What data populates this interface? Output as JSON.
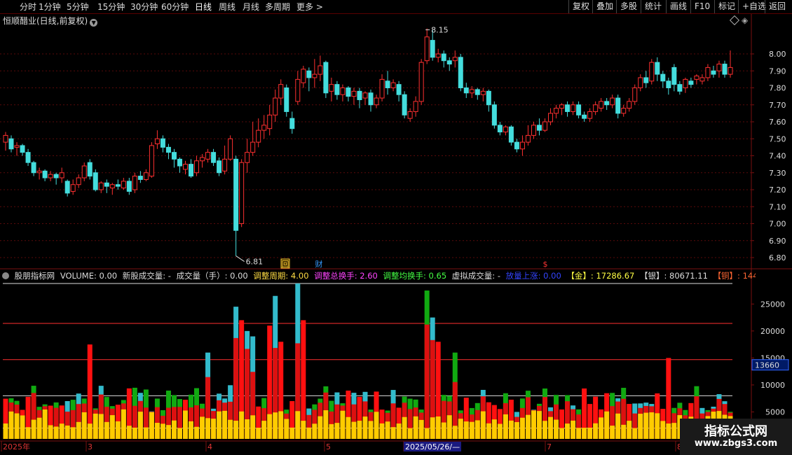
{
  "toolbar": {
    "periods": [
      "分时",
      "1分钟",
      "5分钟",
      "15分钟",
      "30分钟",
      "60分钟",
      "日线",
      "周线",
      "月线",
      "多周期",
      "更多 >"
    ],
    "active_period": "日线",
    "right_buttons": [
      "复权",
      "叠加",
      "多股",
      "统计",
      "画线",
      "F10",
      "标记",
      "+自选",
      "返回"
    ]
  },
  "chart": {
    "title": "恒顺醋业(日线,前复权)",
    "price_axis": [
      "8.00",
      "7.90",
      "7.80",
      "7.70",
      "7.60",
      "7.50",
      "7.40",
      "7.30",
      "7.20",
      "7.10",
      "7.00",
      "6.90",
      "6.80"
    ],
    "high_label": "8.15",
    "low_label": "6.81",
    "markers": [
      "回",
      "财",
      "$"
    ],
    "colors": {
      "up": "#ff3030",
      "down": "#44dddd",
      "grid": "#7a1010"
    }
  },
  "indicator": {
    "name": "股朋指标网",
    "volume": "VOLUME: 0.00",
    "new_stock": "新股成交量: -",
    "vol_hand": "成交量（手）: 0.00",
    "adj_period": "调整周期: 4.00",
    "adj_total_turn": "调整总换手: 2.60",
    "adj_avg_turn": "调整均换手: 0.65",
    "virtual_vol": "虚拟成交量: -",
    "vol_up": "放量上涨: 0.00",
    "gold": "【金】: 17286.67",
    "silver": "【银】: 80671.11",
    "copper": "【铜】: 144055.55",
    "axis": [
      "25000",
      "20000",
      "15000",
      "10000",
      "5000"
    ],
    "current_value": "13660"
  },
  "date_axis": {
    "labels": [
      "2025年",
      "3",
      "4",
      "5",
      "2025/05/26/—",
      "7",
      "8"
    ]
  },
  "watermark": {
    "title": "指标公式网",
    "url": "www.zbgs3.com"
  },
  "chart_data": {
    "type": "candlestick",
    "price_range": [
      6.8,
      8.15
    ],
    "candles": [
      [
        7.48,
        7.52,
        7.43,
        7.54
      ],
      [
        7.5,
        7.44,
        7.42,
        7.52
      ],
      [
        7.45,
        7.46,
        7.4,
        7.48
      ],
      [
        7.46,
        7.42,
        7.4,
        7.47
      ],
      [
        7.42,
        7.36,
        7.34,
        7.44
      ],
      [
        7.36,
        7.3,
        7.28,
        7.37
      ],
      [
        7.3,
        7.31,
        7.26,
        7.33
      ],
      [
        7.31,
        7.27,
        7.25,
        7.32
      ],
      [
        7.27,
        7.29,
        7.25,
        7.31
      ],
      [
        7.29,
        7.27,
        7.23,
        7.3
      ],
      [
        7.27,
        7.3,
        7.24,
        7.33
      ],
      [
        7.25,
        7.18,
        7.16,
        7.26
      ],
      [
        7.19,
        7.23,
        7.17,
        7.26
      ],
      [
        7.23,
        7.27,
        7.21,
        7.29
      ],
      [
        7.27,
        7.34,
        7.25,
        7.36
      ],
      [
        7.36,
        7.28,
        7.26,
        7.38
      ],
      [
        7.3,
        7.2,
        7.19,
        7.32
      ],
      [
        7.2,
        7.24,
        7.18,
        7.25
      ],
      [
        7.24,
        7.22,
        7.18,
        7.26
      ],
      [
        7.21,
        7.23,
        7.17,
        7.24
      ],
      [
        7.23,
        7.22,
        7.2,
        7.26
      ],
      [
        7.21,
        7.25,
        7.2,
        7.27
      ],
      [
        7.25,
        7.19,
        7.17,
        7.27
      ],
      [
        7.2,
        7.28,
        7.18,
        7.3
      ],
      [
        7.28,
        7.26,
        7.24,
        7.31
      ],
      [
        7.26,
        7.3,
        7.25,
        7.32
      ],
      [
        7.28,
        7.46,
        7.27,
        7.48
      ],
      [
        7.47,
        7.5,
        7.44,
        7.55
      ],
      [
        7.5,
        7.45,
        7.42,
        7.52
      ],
      [
        7.45,
        7.42,
        7.38,
        7.47
      ],
      [
        7.42,
        7.38,
        7.33,
        7.44
      ],
      [
        7.38,
        7.34,
        7.3,
        7.39
      ],
      [
        7.32,
        7.35,
        7.29,
        7.37
      ],
      [
        7.35,
        7.28,
        7.27,
        7.38
      ],
      [
        7.3,
        7.37,
        7.28,
        7.4
      ],
      [
        7.37,
        7.39,
        7.33,
        7.41
      ],
      [
        7.38,
        7.42,
        7.36,
        7.44
      ],
      [
        7.42,
        7.36,
        7.34,
        7.44
      ],
      [
        7.37,
        7.3,
        7.28,
        7.39
      ],
      [
        7.31,
        7.38,
        7.29,
        7.46
      ],
      [
        7.38,
        7.5,
        7.37,
        7.52
      ],
      [
        7.38,
        6.96,
        6.81,
        7.4
      ],
      [
        7.0,
        7.36,
        6.98,
        7.38
      ],
      [
        7.36,
        7.42,
        7.3,
        7.5
      ],
      [
        7.42,
        7.48,
        7.4,
        7.6
      ],
      [
        7.48,
        7.55,
        7.45,
        7.62
      ],
      [
        7.55,
        7.58,
        7.5,
        7.64
      ],
      [
        7.56,
        7.64,
        7.52,
        7.7
      ],
      [
        7.64,
        7.74,
        7.6,
        7.79
      ],
      [
        7.74,
        7.82,
        7.7,
        7.85
      ],
      [
        7.8,
        7.66,
        7.63,
        7.82
      ],
      [
        7.62,
        7.56,
        7.53,
        7.66
      ],
      [
        7.72,
        7.85,
        7.7,
        7.9
      ],
      [
        7.83,
        7.91,
        7.8,
        7.93
      ],
      [
        7.9,
        7.86,
        7.78,
        7.92
      ],
      [
        7.86,
        7.88,
        7.8,
        7.97
      ],
      [
        7.88,
        7.93,
        7.84,
        7.99
      ],
      [
        7.95,
        7.77,
        7.74,
        7.96
      ],
      [
        7.78,
        7.82,
        7.72,
        7.86
      ],
      [
        7.82,
        7.76,
        7.73,
        7.84
      ],
      [
        7.76,
        7.8,
        7.72,
        7.82
      ],
      [
        7.8,
        7.75,
        7.72,
        7.81
      ],
      [
        7.75,
        7.78,
        7.7,
        7.8
      ],
      [
        7.78,
        7.73,
        7.68,
        7.8
      ],
      [
        7.74,
        7.77,
        7.7,
        7.78
      ],
      [
        7.77,
        7.7,
        7.66,
        7.79
      ],
      [
        7.7,
        7.74,
        7.68,
        7.76
      ],
      [
        7.74,
        7.85,
        7.72,
        7.88
      ],
      [
        7.84,
        7.8,
        7.76,
        7.9
      ],
      [
        7.8,
        7.83,
        7.78,
        7.85
      ],
      [
        7.82,
        7.76,
        7.72,
        7.84
      ],
      [
        7.76,
        7.64,
        7.62,
        7.78
      ],
      [
        7.62,
        7.66,
        7.6,
        7.68
      ],
      [
        7.66,
        7.72,
        7.63,
        7.75
      ],
      [
        7.72,
        7.95,
        7.7,
        7.97
      ],
      [
        7.96,
        8.1,
        7.94,
        8.15
      ],
      [
        8.08,
        7.98,
        7.96,
        8.14
      ],
      [
        7.98,
        8.0,
        7.95,
        8.03
      ],
      [
        8.0,
        7.96,
        7.92,
        8.02
      ],
      [
        7.96,
        7.94,
        7.9,
        7.98
      ],
      [
        7.96,
        7.98,
        7.92,
        8.02
      ],
      [
        7.98,
        7.8,
        7.78,
        8.0
      ],
      [
        7.8,
        7.77,
        7.74,
        7.83
      ],
      [
        7.77,
        7.79,
        7.74,
        7.81
      ],
      [
        7.79,
        7.76,
        7.73,
        7.8
      ],
      [
        7.76,
        7.78,
        7.72,
        7.8
      ],
      [
        7.78,
        7.7,
        7.66,
        7.79
      ],
      [
        7.7,
        7.58,
        7.56,
        7.72
      ],
      [
        7.58,
        7.54,
        7.52,
        7.6
      ],
      [
        7.54,
        7.57,
        7.52,
        7.58
      ],
      [
        7.57,
        7.48,
        7.46,
        7.58
      ],
      [
        7.48,
        7.44,
        7.42,
        7.5
      ],
      [
        7.44,
        7.48,
        7.4,
        7.52
      ],
      [
        7.48,
        7.52,
        7.46,
        7.58
      ],
      [
        7.52,
        7.58,
        7.5,
        7.6
      ],
      [
        7.58,
        7.55,
        7.52,
        7.62
      ],
      [
        7.55,
        7.6,
        7.54,
        7.62
      ],
      [
        7.6,
        7.65,
        7.58,
        7.68
      ],
      [
        7.65,
        7.68,
        7.62,
        7.7
      ],
      [
        7.68,
        7.7,
        7.64,
        7.71
      ],
      [
        7.7,
        7.66,
        7.63,
        7.72
      ],
      [
        7.66,
        7.7,
        7.64,
        7.72
      ],
      [
        7.7,
        7.64,
        7.62,
        7.72
      ],
      [
        7.64,
        7.62,
        7.6,
        7.66
      ],
      [
        7.62,
        7.66,
        7.6,
        7.68
      ],
      [
        7.66,
        7.7,
        7.64,
        7.72
      ],
      [
        7.68,
        7.72,
        7.66,
        7.74
      ],
      [
        7.72,
        7.7,
        7.67,
        7.74
      ],
      [
        7.7,
        7.74,
        7.68,
        7.76
      ],
      [
        7.74,
        7.65,
        7.62,
        7.76
      ],
      [
        7.65,
        7.68,
        7.63,
        7.7
      ],
      [
        7.68,
        7.72,
        7.66,
        7.74
      ],
      [
        7.72,
        7.8,
        7.7,
        7.82
      ],
      [
        7.8,
        7.86,
        7.78,
        7.88
      ],
      [
        7.86,
        7.83,
        7.8,
        7.9
      ],
      [
        7.84,
        7.95,
        7.82,
        7.97
      ],
      [
        7.95,
        7.88,
        7.84,
        7.98
      ],
      [
        7.88,
        7.84,
        7.8,
        7.9
      ],
      [
        7.84,
        7.8,
        7.76,
        7.86
      ],
      [
        7.92,
        7.82,
        7.78,
        7.94
      ],
      [
        7.82,
        7.78,
        7.76,
        7.84
      ],
      [
        7.8,
        7.85,
        7.77,
        7.86
      ],
      [
        7.84,
        7.82,
        7.8,
        7.86
      ],
      [
        7.85,
        7.87,
        7.82,
        7.88
      ],
      [
        7.84,
        7.86,
        7.82,
        7.88
      ],
      [
        7.86,
        7.92,
        7.84,
        7.94
      ],
      [
        7.9,
        7.88,
        7.86,
        7.93
      ],
      [
        7.9,
        7.94,
        7.86,
        7.96
      ],
      [
        7.94,
        7.88,
        7.86,
        7.96
      ],
      [
        7.88,
        7.92,
        7.86,
        8.02
      ]
    ],
    "volume_axis": [
      5000,
      10000,
      15000,
      20000,
      25000
    ],
    "volume_lines": [
      13660
    ]
  }
}
